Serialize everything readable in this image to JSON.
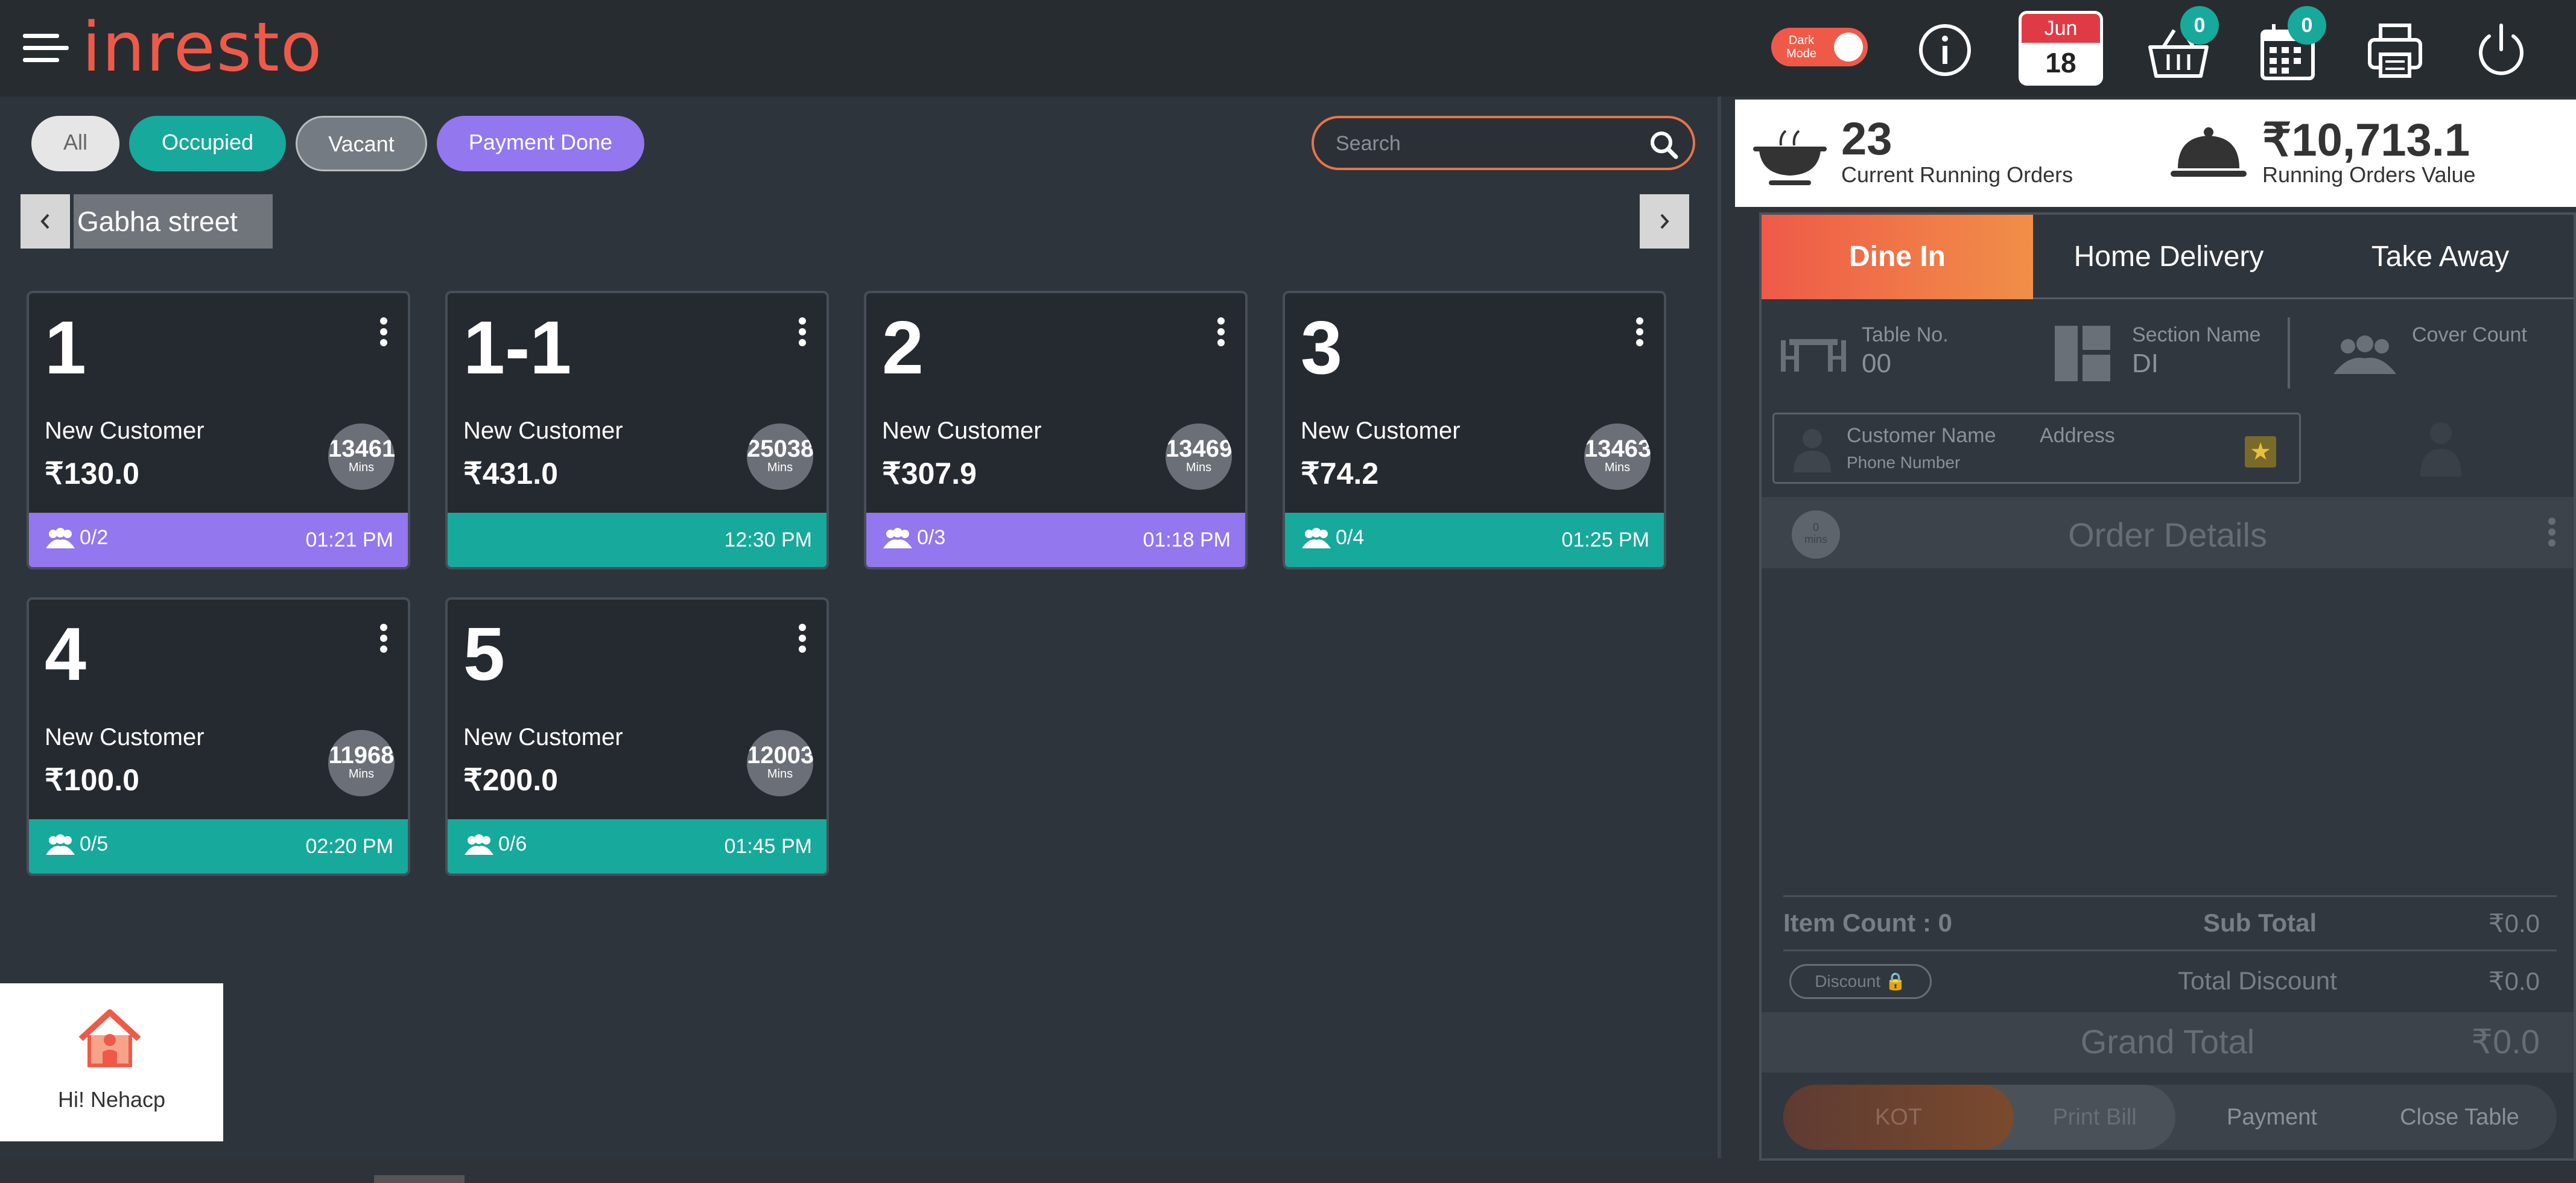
{
  "header": {
    "logo": "inresto",
    "dark_mode_label": "Dark Mode",
    "calendar_month": "Jun",
    "calendar_day": "18",
    "basket_badge": "0",
    "schedule_badge": "0"
  },
  "filters": {
    "all": "All",
    "occupied": "Occupied",
    "vacant": "Vacant",
    "payment_done": "Payment Done"
  },
  "search": {
    "placeholder": "Search"
  },
  "section": {
    "name": "Gabha street"
  },
  "tables": [
    {
      "number": "1",
      "customer": "New Customer",
      "amount": "₹130.0",
      "mins": "13461",
      "mins_label": "Mins",
      "guests": "0/2",
      "time": "01:21 PM",
      "status": "payment_done"
    },
    {
      "number": "1-1",
      "customer": "New Customer",
      "amount": "₹431.0",
      "mins": "25038",
      "mins_label": "Mins",
      "guests": "",
      "time": "12:30 PM",
      "status": "occupied"
    },
    {
      "number": "2",
      "customer": "New Customer",
      "amount": "₹307.9",
      "mins": "13469",
      "mins_label": "Mins",
      "guests": "0/3",
      "time": "01:18 PM",
      "status": "payment_done"
    },
    {
      "number": "3",
      "customer": "New Customer",
      "amount": "₹74.2",
      "mins": "13463",
      "mins_label": "Mins",
      "guests": "0/4",
      "time": "01:25 PM",
      "status": "occupied"
    },
    {
      "number": "4",
      "customer": "New Customer",
      "amount": "₹100.0",
      "mins": "11968",
      "mins_label": "Mins",
      "guests": "0/5",
      "time": "02:20 PM",
      "status": "occupied"
    },
    {
      "number": "5",
      "customer": "New Customer",
      "amount": "₹200.0",
      "mins": "12003",
      "mins_label": "Mins",
      "guests": "0/6",
      "time": "01:45 PM",
      "status": "occupied"
    }
  ],
  "user": {
    "greeting": "Hi! Nehacp"
  },
  "summary": {
    "running_orders": "23",
    "running_orders_label": "Current Running Orders",
    "running_value": "₹10,713.1",
    "running_value_label": "Running Orders Value"
  },
  "order_tabs": [
    "Dine In",
    "Home Delivery",
    "Take Away"
  ],
  "order_info": {
    "table_label": "Table No.",
    "table_value": "00",
    "section_label": "Section Name",
    "section_value": "DI",
    "cover_label": "Cover Count"
  },
  "customer": {
    "name_label": "Customer Name",
    "phone_label": "Phone Number",
    "address_label": "Address"
  },
  "order_details": {
    "mins_value": "0",
    "mins_label": "mins",
    "title": "Order Details"
  },
  "totals": {
    "item_count": "Item Count : 0",
    "sub_total_label": "Sub Total",
    "sub_total": "₹0.0",
    "discount_button": "Discount 🔒",
    "total_discount_label": "Total Discount",
    "total_discount": "₹0.0",
    "grand_total_label": "Grand Total",
    "grand_total": "₹0.0"
  },
  "actions": {
    "kot": "KOT",
    "print_bill": "Print Bill",
    "payment": "Payment",
    "close_table": "Close Table"
  },
  "colors": {
    "accent": "#ef5a48",
    "occupied": "#17a99b",
    "payment_done": "#9277ef",
    "vacant": "#757b83"
  }
}
